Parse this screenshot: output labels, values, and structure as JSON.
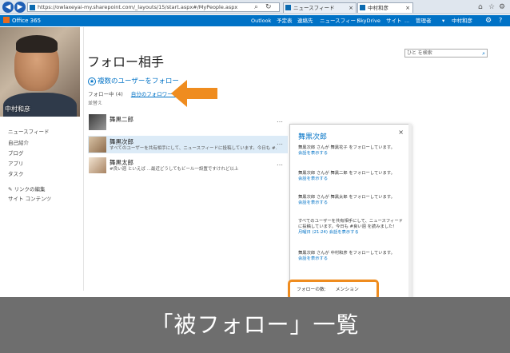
{
  "browser": {
    "url": "https://owlaxeyai-my.sharepoint.com/_layouts/15/start.aspx#/MyPeople.aspx",
    "tabs": [
      {
        "label": "ニュースフィード"
      },
      {
        "label": "中村和彦"
      }
    ]
  },
  "suite_bar": {
    "brand": "Office 365",
    "nav": [
      "Outlook",
      "予定表",
      "連絡先",
      "ニュースフィード",
      "SkyDrive",
      "サイト",
      "...",
      "管理者"
    ],
    "user": "中村和彦",
    "settings_icon": "gear-icon",
    "help_icon": "question-icon"
  },
  "profile": {
    "name": "中村和彦"
  },
  "left_nav": [
    "ニュースフィード",
    "自己紹介",
    "ブログ",
    "アプリ",
    "タスク",
    "リンクの編集",
    "サイト コンテンツ"
  ],
  "page": {
    "title": "フォロー相手",
    "search_placeholder": "ひと を検索",
    "follow_multiple": "複数のユーザーをフォロー",
    "tab_following": "フォロー中 (4)",
    "tab_followers": "自分のフォロワー (3)",
    "sort_label": "並替え"
  },
  "followers": [
    {
      "name": "舞黒二郎",
      "text": ""
    },
    {
      "name": "舞黒次郎",
      "text": "すべてのユーザーを共有相手にして、ニュースフィードに投稿しています。今日も #..."
    },
    {
      "name": "舞黒太郎",
      "text": "#良い週 といえば ...最近どうしてもビール一設置ですけれど以上"
    }
  ],
  "callout": {
    "title": "舞黒次郎",
    "entries": [
      {
        "line1": "舞黒次郎 さんが 舞黒花子 をフォローしています。",
        "line2": "会話を表示する"
      },
      {
        "line1": "舞黒次郎 さんが 舞黒二郎 をフォローしています。",
        "line2": "会話を表示する"
      },
      {
        "line1": "舞黒次郎 さんが 舞黒太郎 をフォローしています。",
        "line2": "会話を表示する"
      },
      {
        "line1": "すべてのユーザーを共有相手にして、ニュースフィードに投稿しています。今日も #良い週 を読みました！",
        "line2": "月曜日 (21:24)   会話を表示する"
      },
      {
        "line1": "舞黒次郎 さんが 中村和彦 をフォローしています。",
        "line2": "会話を表示する"
      }
    ],
    "footer_followers": "フォローの数:",
    "footer_mention": "メンション"
  },
  "banner": {
    "text": "「被フォロー」一覧"
  },
  "colors": {
    "accent": "#0072c6",
    "annotation": "#ef8c1f",
    "banner_bg": "#6e6e6e"
  }
}
